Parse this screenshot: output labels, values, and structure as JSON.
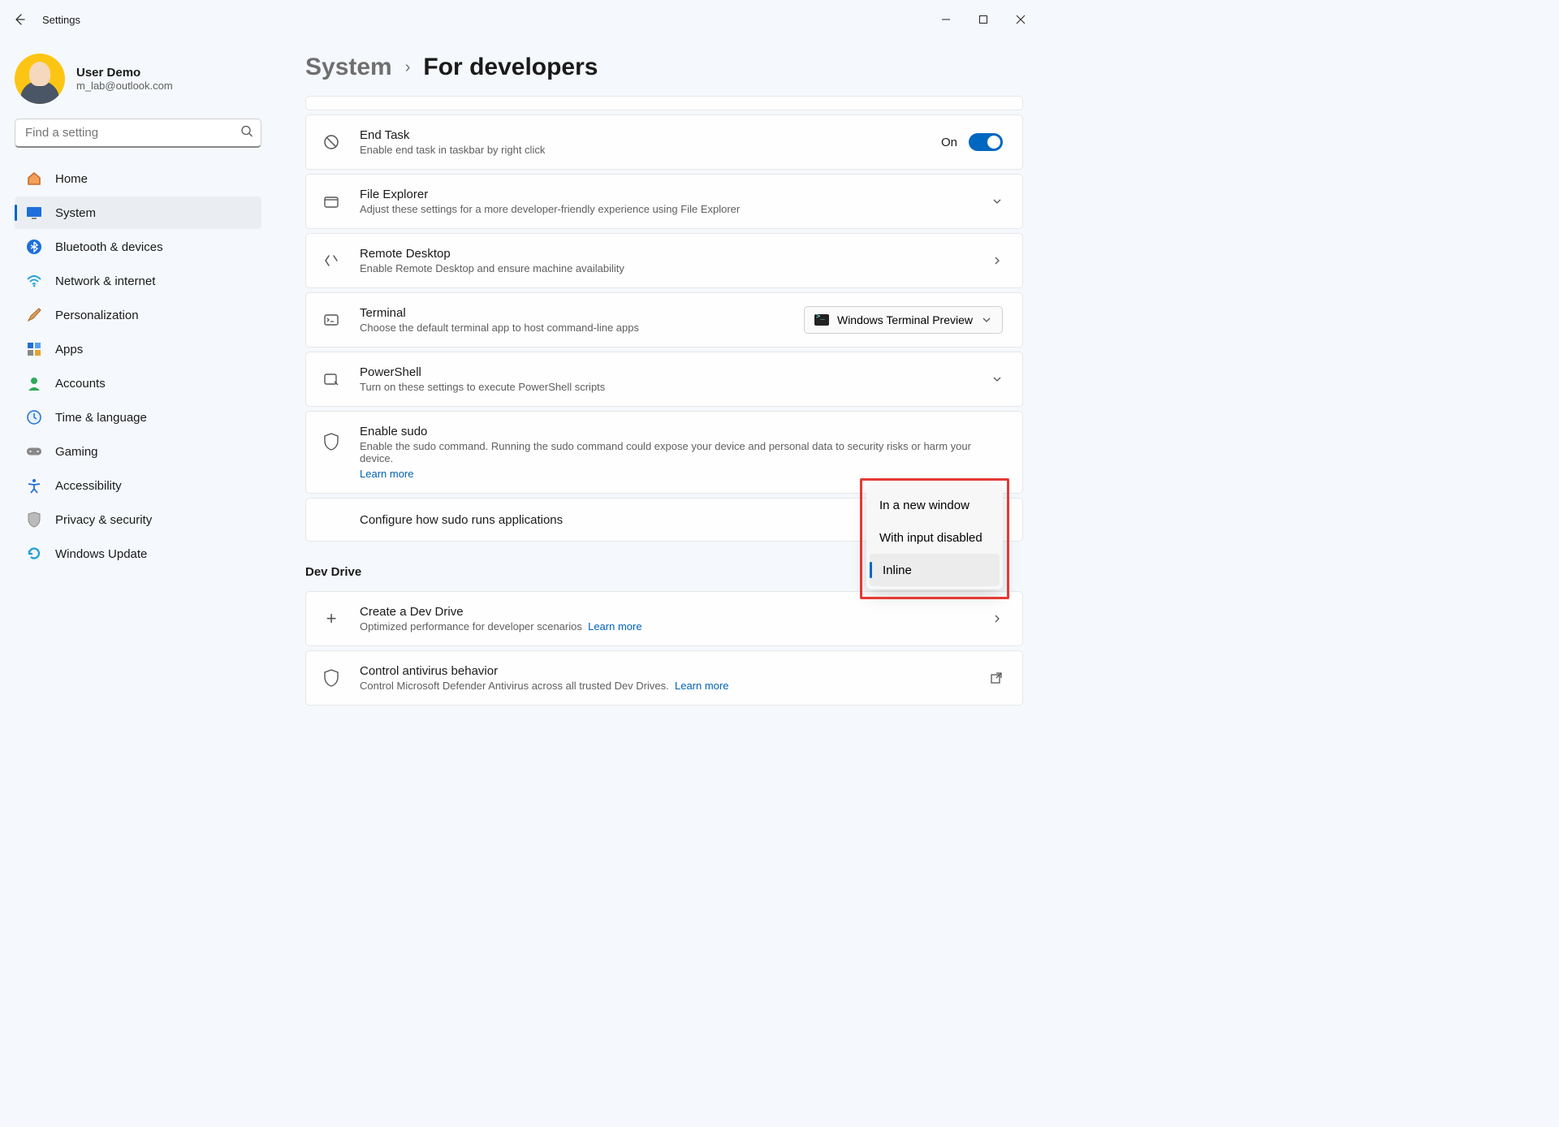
{
  "window": {
    "title": "Settings"
  },
  "user": {
    "name": "User Demo",
    "email": "m_lab@outlook.com"
  },
  "search": {
    "placeholder": "Find a setting"
  },
  "nav": [
    {
      "label": "Home",
      "icon": "home"
    },
    {
      "label": "System",
      "icon": "system",
      "active": true
    },
    {
      "label": "Bluetooth & devices",
      "icon": "bluetooth"
    },
    {
      "label": "Network & internet",
      "icon": "wifi"
    },
    {
      "label": "Personalization",
      "icon": "brush"
    },
    {
      "label": "Apps",
      "icon": "apps"
    },
    {
      "label": "Accounts",
      "icon": "account"
    },
    {
      "label": "Time & language",
      "icon": "clock"
    },
    {
      "label": "Gaming",
      "icon": "gamepad"
    },
    {
      "label": "Accessibility",
      "icon": "accessibility"
    },
    {
      "label": "Privacy & security",
      "icon": "shield"
    },
    {
      "label": "Windows Update",
      "icon": "update"
    }
  ],
  "breadcrumb": {
    "parent": "System",
    "page": "For developers"
  },
  "cards": {
    "end_task": {
      "title": "End Task",
      "desc": "Enable end task in taskbar by right click",
      "state_label": "On"
    },
    "file_explorer": {
      "title": "File Explorer",
      "desc": "Adjust these settings for a more developer-friendly experience using File Explorer"
    },
    "remote_desktop": {
      "title": "Remote Desktop",
      "desc": "Enable Remote Desktop and ensure machine availability"
    },
    "terminal": {
      "title": "Terminal",
      "desc": "Choose the default terminal app to host command-line apps",
      "value": "Windows Terminal Preview"
    },
    "powershell": {
      "title": "PowerShell",
      "desc": "Turn on these settings to execute PowerShell scripts"
    },
    "sudo": {
      "title": "Enable sudo",
      "desc": "Enable the sudo command. Running the sudo command could expose your device and personal data to security risks or harm your device.",
      "link": "Learn more"
    },
    "sudo_config": {
      "title": "Configure how sudo runs applications"
    }
  },
  "sudo_options": [
    {
      "label": "In a new window"
    },
    {
      "label": "With input disabled"
    },
    {
      "label": "Inline",
      "selected": true
    }
  ],
  "dev_drive": {
    "heading": "Dev Drive",
    "create": {
      "title": "Create a Dev Drive",
      "desc": "Optimized performance for developer scenarios",
      "link": "Learn more"
    },
    "antivirus": {
      "title": "Control antivirus behavior",
      "desc": "Control Microsoft Defender Antivirus across all trusted Dev Drives.",
      "link": "Learn more"
    }
  }
}
